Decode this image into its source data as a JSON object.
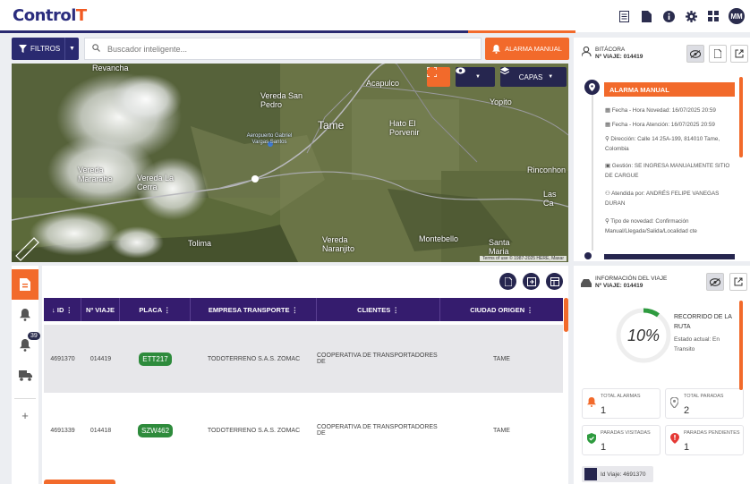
{
  "header": {
    "logo_main": "Control",
    "logo_accent": "T",
    "avatar_initials": "MM"
  },
  "toolbar": {
    "filters_label": "FILTROS",
    "search_placeholder": "Buscador inteligente...",
    "alarm_button": "ALARMA MANUAL"
  },
  "map": {
    "layers_label": "CAPAS",
    "labels": [
      "Revancha",
      "Vereda San Pedro",
      "Acapulco",
      "Yopito",
      "Tame",
      "Hato El Porvenir",
      "Aeropuerto Gabriel Vargas Santos",
      "Vereda Mararabe",
      "Vereda La Cerra",
      "Rinconhon",
      "Las Ca",
      "Tolima",
      "Vereda Naranjito",
      "Montebello",
      "Santa Maria"
    ],
    "attribution": "Terms of use   © 1987-2025 HERE, Maxar"
  },
  "rail": {
    "badge_count": "39",
    "add_label": "+"
  },
  "table": {
    "columns": [
      "↓ ID ⋮",
      "Nº VIAJE",
      "PLACA ⋮",
      "EMPRESA TRANSPORTE ⋮",
      "CLIENTES ⋮",
      "CIUDAD ORIGEN ⋮"
    ],
    "rows": [
      {
        "id": "4691370",
        "viaje": "014419",
        "placa": "ETT217",
        "empresa": "TODOTERRENO S.A.S. ZOMAC",
        "cliente": "COOPERATIVA DE TRANSPORTADORES DE",
        "origen": "TAME"
      },
      {
        "id": "4691339",
        "viaje": "014418",
        "placa": "SZW462",
        "empresa": "TODOTERRENO S.A.S. ZOMAC",
        "cliente": "COOPERATIVA DE TRANSPORTADORES DE",
        "origen": "TAME"
      }
    ]
  },
  "bitacora": {
    "title": "BITÁCORA",
    "trip_label": "Nº VIAJE: 014419",
    "alarm_title": "ALARMA MANUAL",
    "fecha_novedad": "Fecha - Hora Novedad: 16/07/2025 20:59",
    "fecha_atencion": "Fecha - Hora Atención: 16/07/2025 20:59",
    "direccion": "Dirección: Calle 14 25A-199, 814010 Tame, Colombia",
    "gestion": "Gestión: SE INGRESA MANUALMENTE SITIO DE CARGUE",
    "atendida": "Atendida por: ANDRÉS FELIPE VANEGAS DURAN",
    "tipo": "Tipo de novedad: Confirmación Manual/Llegada/Salida/Localidad cte"
  },
  "trip_info": {
    "title": "INFORMACIÓN DEL VIAJE",
    "trip_label": "Nº VIAJE: 014419",
    "progress_pct": 10,
    "progress_text": "10%",
    "route_title": "RECORRIDO DE LA RUTA",
    "status_text": "Estado actual: En Transito",
    "total_alarmas_label": "TOTAL ALARMAS",
    "total_alarmas": "1",
    "total_paradas_label": "TOTAL PARADAS",
    "total_paradas": "2",
    "paradas_visitadas_label": "PARADAS VISITADAS",
    "paradas_visitadas": "1",
    "paradas_pendientes_label": "PARADAS PENDIENTES",
    "paradas_pendientes": "1",
    "id_viaje": "Id Viaje: 4691370"
  },
  "colors": {
    "accent": "#f26a2b",
    "navy": "#26264f",
    "purple": "#351c6e",
    "green": "#2e8b3c"
  }
}
